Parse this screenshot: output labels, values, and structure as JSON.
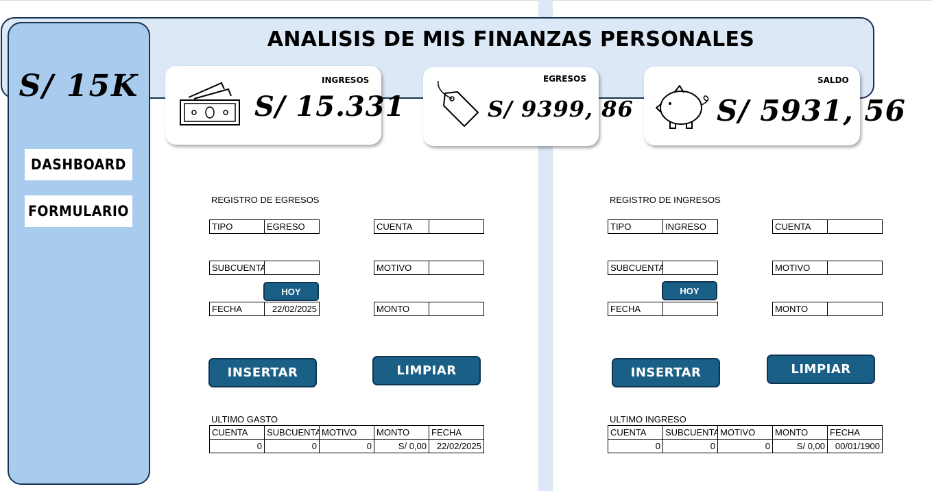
{
  "header": {
    "title": "ANALISIS DE MIS FINANZAS PERSONALES"
  },
  "sidebar": {
    "total": "S/ 15K",
    "buttons": [
      {
        "label": "DASHBOARD"
      },
      {
        "label": "FORMULARIO"
      }
    ]
  },
  "cards": {
    "ingresos": {
      "label": "INGRESOS",
      "value": "S/ 15.331",
      "icon": "money-icon"
    },
    "egresos": {
      "label": "EGRESOS",
      "value": "S/ 9399, 86",
      "icon": "price-tag-icon"
    },
    "saldo": {
      "label": "SALDO",
      "value": "S/ 5931, 56",
      "icon": "piggy-bank-icon"
    }
  },
  "egresos_form": {
    "title": "REGISTRO DE EGRESOS",
    "tipo_label": "TIPO",
    "tipo_value": "EGRESO",
    "cuenta_label": "CUENTA",
    "cuenta_value": "",
    "subcuenta_label": "SUBCUENTA",
    "subcuenta_value": "",
    "motivo_label": "MOTIVO",
    "motivo_value": "",
    "hoy_label": "HOY",
    "fecha_label": "FECHA",
    "fecha_value": "22/02/2025",
    "monto_label": "MONTO",
    "monto_value": "",
    "insertar_label": "INSERTAR",
    "limpiar_label": "LIMPIAR",
    "last_title": "ULTIMO GASTO",
    "columns": [
      "CUENTA",
      "SUBCUENTA",
      "MOTIVO",
      "MONTO",
      "FECHA"
    ],
    "row": [
      "0",
      "0",
      "0",
      "S/ 0,00",
      "22/02/2025"
    ]
  },
  "ingresos_form": {
    "title": "REGISTRO DE INGRESOS",
    "tipo_label": "TIPO",
    "tipo_value": "INGRESO",
    "cuenta_label": "CUENTA",
    "cuenta_value": "",
    "subcuenta_label": "SUBCUENTA",
    "subcuenta_value": "",
    "motivo_label": "MOTIVO",
    "motivo_value": "",
    "hoy_label": "HOY",
    "fecha_label": "FECHA",
    "fecha_value": "",
    "monto_label": "MONTO",
    "monto_value": "",
    "insertar_label": "INSERTAR",
    "limpiar_label": "LIMPIAR",
    "last_title": "ULTIMO INGRESO",
    "columns": [
      "CUENTA",
      "SUBCUENTA",
      "MOTIVO",
      "MONTO",
      "FECHA"
    ],
    "row": [
      "0",
      "0",
      "0",
      "S/ 0,00",
      "00/01/1900"
    ]
  },
  "colors": {
    "sidebar_bg": "#a9ccee",
    "header_bg": "#dce8f6",
    "button_bg": "#1a5f86",
    "border": "#16324f"
  }
}
